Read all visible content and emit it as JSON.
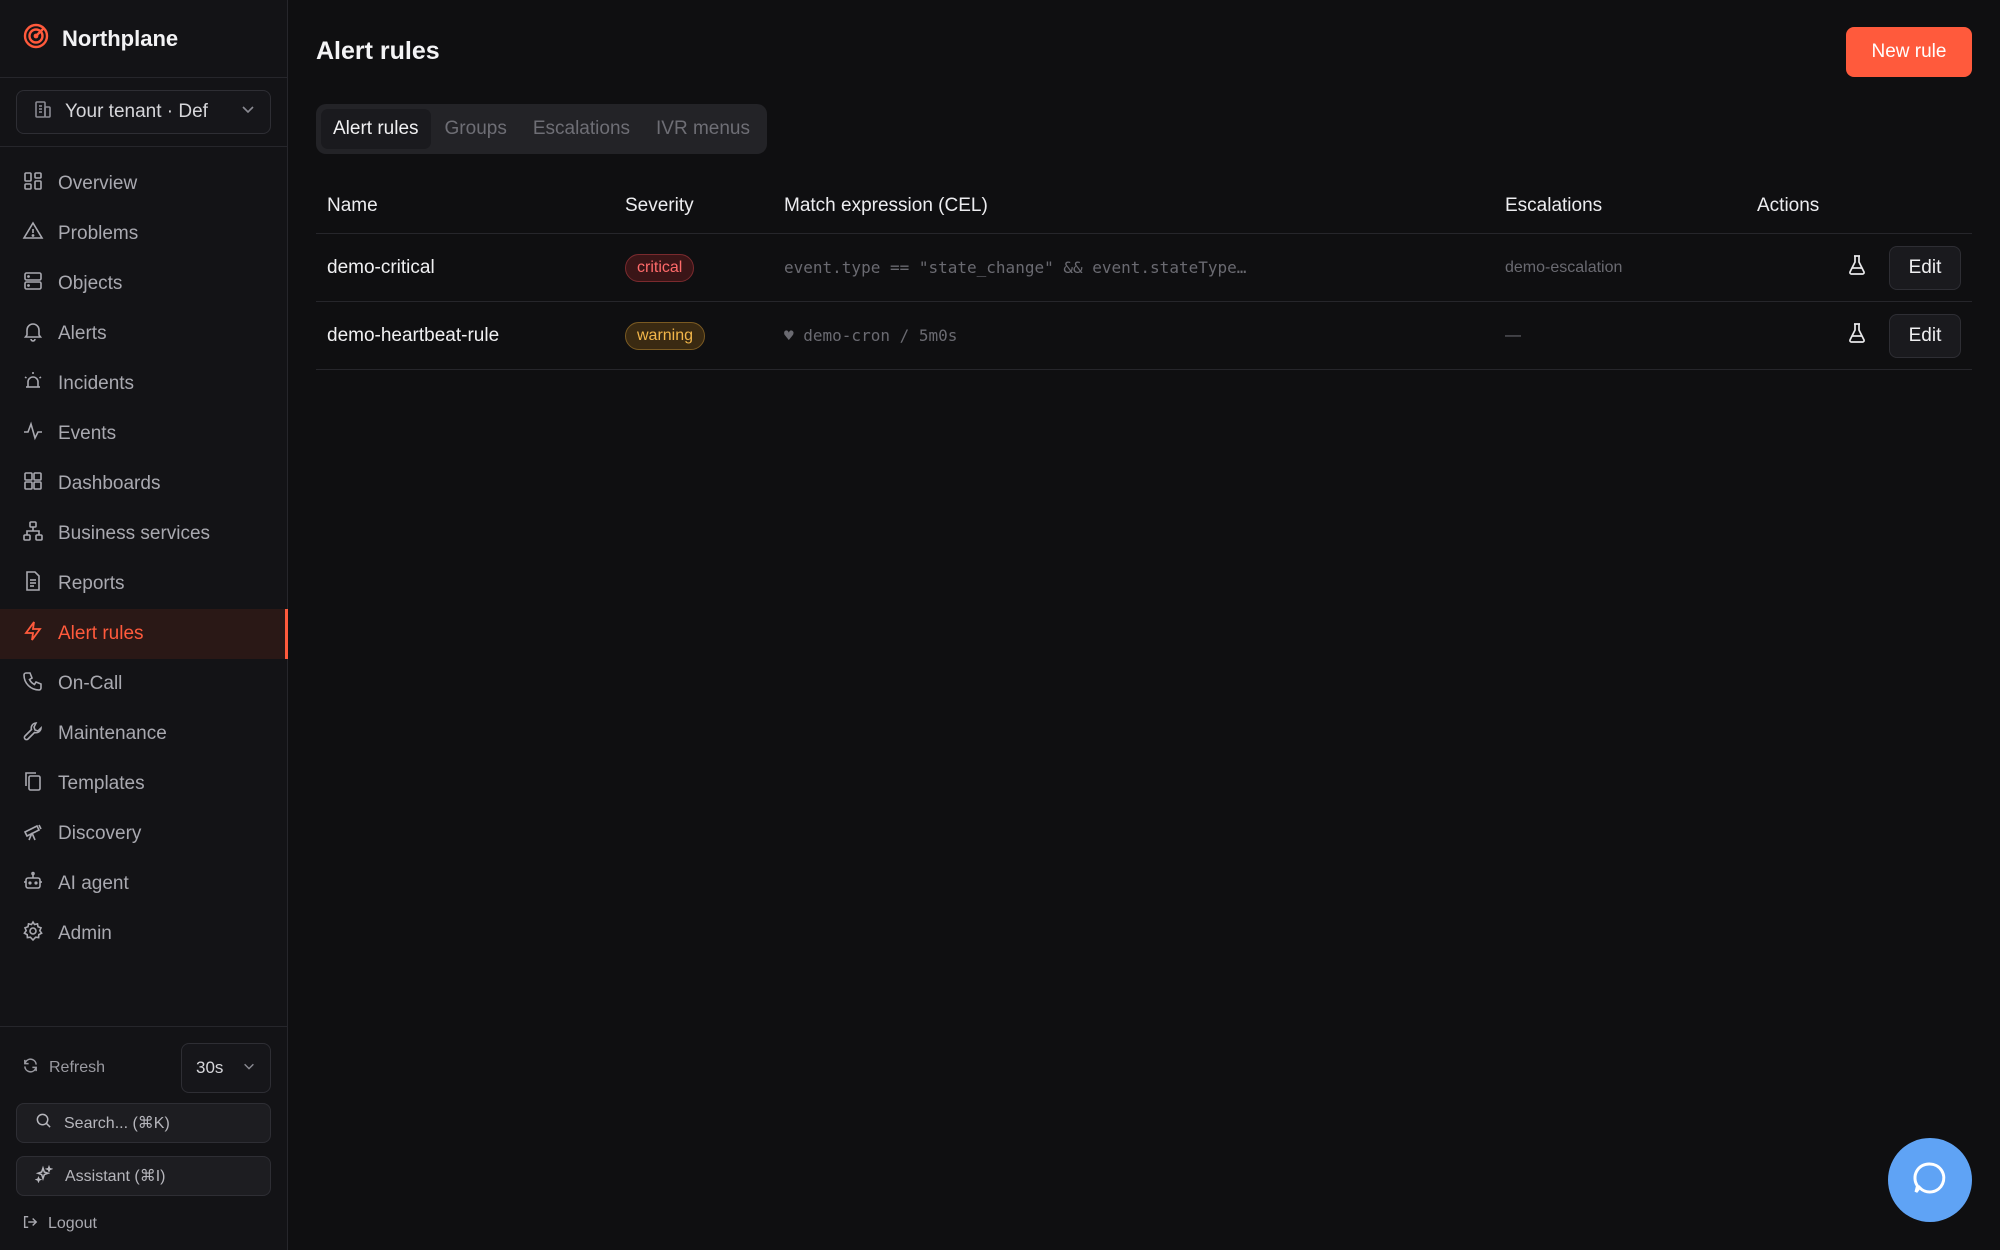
{
  "brand": {
    "name": "Northplane"
  },
  "tenant": {
    "label": "Your tenant · Def"
  },
  "nav": [
    {
      "label": "Overview",
      "icon": "grid-icon"
    },
    {
      "label": "Problems",
      "icon": "warning-triangle-icon"
    },
    {
      "label": "Objects",
      "icon": "server-icon"
    },
    {
      "label": "Alerts",
      "icon": "bell-icon"
    },
    {
      "label": "Incidents",
      "icon": "siren-icon"
    },
    {
      "label": "Events",
      "icon": "activity-icon"
    },
    {
      "label": "Dashboards",
      "icon": "dashboard-icon"
    },
    {
      "label": "Business services",
      "icon": "network-icon"
    },
    {
      "label": "Reports",
      "icon": "document-icon"
    },
    {
      "label": "Alert rules",
      "icon": "lightning-icon",
      "active": true
    },
    {
      "label": "On-Call",
      "icon": "phone-icon"
    },
    {
      "label": "Maintenance",
      "icon": "wrench-icon"
    },
    {
      "label": "Templates",
      "icon": "copy-icon"
    },
    {
      "label": "Discovery",
      "icon": "telescope-icon"
    },
    {
      "label": "AI agent",
      "icon": "bot-icon"
    },
    {
      "label": "Admin",
      "icon": "gear-icon"
    }
  ],
  "sidebar_bottom": {
    "refresh_label": "Refresh",
    "interval": "30s",
    "search_label": "Search... (⌘K)",
    "assistant_label": "Assistant (⌘I)",
    "logout_label": "Logout"
  },
  "header": {
    "title": "Alert rules",
    "new_rule_label": "New rule"
  },
  "tabs": [
    {
      "label": "Alert rules",
      "active": true
    },
    {
      "label": "Groups"
    },
    {
      "label": "Escalations"
    },
    {
      "label": "IVR menus"
    }
  ],
  "table": {
    "columns": [
      "Name",
      "Severity",
      "Match expression (CEL)",
      "Escalations",
      "Actions"
    ],
    "rows": [
      {
        "name": "demo-critical",
        "severity": "critical",
        "expression": "event.type == \"state_change\" && event.stateType…",
        "escalations": "demo-escalation",
        "edit_label": "Edit"
      },
      {
        "name": "demo-heartbeat-rule",
        "severity": "warning",
        "expression": "♥ demo-cron / 5m0s",
        "escalations": "—",
        "edit_label": "Edit"
      }
    ]
  },
  "colors": {
    "accent": "#ff5a3c",
    "critical": "#ff6a6a",
    "warning": "#f2b64a",
    "chat_fab": "#5fa3f5"
  }
}
